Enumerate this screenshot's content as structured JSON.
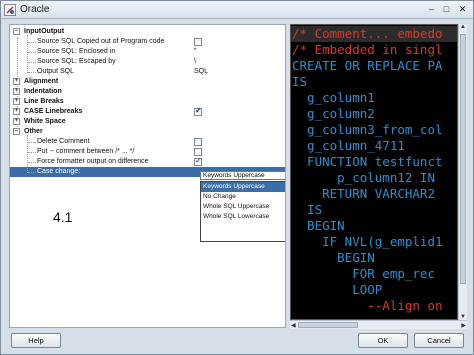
{
  "window": {
    "title": "Oracle"
  },
  "tree": {
    "rows": [
      {
        "label": "InputOutput",
        "group": true,
        "expander": "–"
      },
      {
        "label": "Source SQL Copied out of Program code",
        "value_type": "checkbox",
        "checked": false
      },
      {
        "label": "Source SQL: Enclosed in",
        "value": "\""
      },
      {
        "label": "Source SQL: Escaped by",
        "value": "\\"
      },
      {
        "label": "Output SQL",
        "value": "SQL"
      },
      {
        "label": "Alignment",
        "group": true,
        "expander": "+"
      },
      {
        "label": "Indentation",
        "group": true,
        "expander": "+"
      },
      {
        "label": "Line Breaks",
        "group": true,
        "expander": "+"
      },
      {
        "label": "CASE Linebreaks",
        "group": true,
        "expander": "+",
        "value_type": "checkbox",
        "checked": true
      },
      {
        "label": "White Space",
        "group": true,
        "expander": "+"
      },
      {
        "label": "Other",
        "group": true,
        "expander": "–"
      },
      {
        "label": "Delete Comment",
        "value_type": "checkbox",
        "checked": false
      },
      {
        "label": "Put -- comment between /* ... */",
        "value_type": "checkbox",
        "checked": false
      },
      {
        "label": "Force formatter output on difference",
        "value_type": "checkbox",
        "checked": true
      },
      {
        "label": "Case change:",
        "selected": true
      }
    ]
  },
  "case_change": {
    "selected": "Keywords Uppercase",
    "options": [
      "Keywords Uppercase",
      "No Change",
      "Whole SQL Uppercase",
      "Whole SQL Lowercase"
    ]
  },
  "version_label": "4.1",
  "code": {
    "lines": [
      {
        "text": "/* Comment... embedo",
        "kind": "comment"
      },
      {
        "text": "/* Embedded in singl",
        "kind": "comment"
      },
      {
        "text": "CREATE OR REPLACE PA",
        "kind": "code"
      },
      {
        "text": "IS",
        "kind": "code"
      },
      {
        "text": "  g_column1",
        "kind": "code"
      },
      {
        "text": "  g_column2",
        "kind": "code"
      },
      {
        "text": "  g_column3_from_col",
        "kind": "code"
      },
      {
        "text": "  g_column_4711",
        "kind": "code"
      },
      {
        "text": "  FUNCTION testfunct",
        "kind": "code"
      },
      {
        "text": "      p_column12 IN",
        "kind": "code"
      },
      {
        "text": "    RETURN VARCHAR2",
        "kind": "code"
      },
      {
        "text": "  IS",
        "kind": "code"
      },
      {
        "text": "  BEGIN",
        "kind": "code"
      },
      {
        "text": "    IF NVL(g_emplid1",
        "kind": "code"
      },
      {
        "text": "      BEGIN",
        "kind": "code"
      },
      {
        "text": "        FOR emp_rec",
        "kind": "code"
      },
      {
        "text": "        LOOP",
        "kind": "code"
      },
      {
        "text": "          --Align on",
        "kind": "comment"
      }
    ]
  },
  "buttons": {
    "help": "Help",
    "ok": "OK",
    "cancel": "Cancel"
  },
  "colors": {
    "code_bg": "#000000",
    "keyword": "#2a8fd0",
    "comment": "#d83a2a",
    "selection": "#3a6ea5"
  }
}
